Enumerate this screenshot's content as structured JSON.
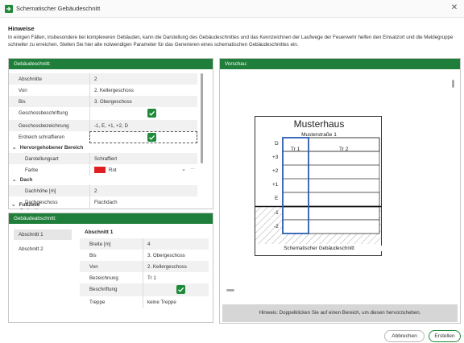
{
  "window": {
    "title": "Schematischer Gebäudeschnitt",
    "close": "✕"
  },
  "hint": {
    "title": "Hinweise",
    "text": "In einigen Fällen, insbesondere bei komplexeren Gebäuden, kann die Darstellung des Gebäudeschnittes und das Kennzeichnen der Laufwege der Feuerwehr helfen den Einsatzort und die Meldegruppe schneller zu erreichen. Stellen Sie hier alle notwendigen Parameter für das Generieren eines schematischen Gebäudeschnittes ein."
  },
  "cross_section_panel": {
    "title": "Gebäudeschnitt:",
    "rows": [
      {
        "label": "Abschnitte",
        "value": "2"
      },
      {
        "label": "Von",
        "value": "2. Kellergeschoss"
      },
      {
        "label": "Bis",
        "value": "3. Obergeschoss"
      },
      {
        "label": "Geschossbeschriftung",
        "value": ""
      },
      {
        "label": "Geschossbezeichnung",
        "value": "-1, E, +1, +2, D"
      },
      {
        "label": "Erdreich schraffieren",
        "value": ""
      }
    ],
    "highlighted_category": "Hervorgehobener Bereich",
    "highlighted_rows": [
      {
        "label": "Darstellungsart",
        "value": "Schraffiert"
      },
      {
        "label": "Farbe",
        "value": "Rot"
      }
    ],
    "color_controls": {
      "dropdown": "⌄",
      "more": "···"
    },
    "roof_category": "Dach",
    "roof_rows": [
      {
        "label": "Dachhöhe [m]",
        "value": "2"
      },
      {
        "label": "Dachgeschoss",
        "value": "Flachdach"
      }
    ],
    "footer_category": "Fußzeile"
  },
  "section_panel": {
    "title": "Gebäudeabschnitt:",
    "list": [
      "Abschnitt 1",
      "Abschnitt 2"
    ],
    "detail_title": "Abschnitt 1",
    "rows": [
      {
        "label": "Breite [m]",
        "value": "4"
      },
      {
        "label": "Bis",
        "value": "3. Obergeschoss"
      },
      {
        "label": "Von",
        "value": "2. Kellergeschoss"
      },
      {
        "label": "Bezeichnung",
        "value": "Tr 1"
      },
      {
        "label": "Beschriftung",
        "value": ""
      },
      {
        "label": "Treppe",
        "value": "keine Treppe"
      }
    ]
  },
  "preview_panel": {
    "title": "Vorschau:",
    "building_title": "Musterhaus",
    "address": "Musterstraße 1",
    "stair_labels": [
      "Tr 1",
      "Tr 2"
    ],
    "floor_labels": [
      "D",
      "+3",
      "+2",
      "+1",
      "E",
      "-1",
      "-2"
    ],
    "caption": "Schematischer Gebäudeschnitt",
    "hint": "Hinweis: Doppelklicken Sie auf einen Bereich, um diesen hervorzuheben."
  },
  "buttons": {
    "cancel": "Abbrechen",
    "create": "Erstellen"
  },
  "colors": {
    "accent": "#1f7f3a",
    "highlight": "#2a5db0",
    "hatch": "#e02020"
  }
}
